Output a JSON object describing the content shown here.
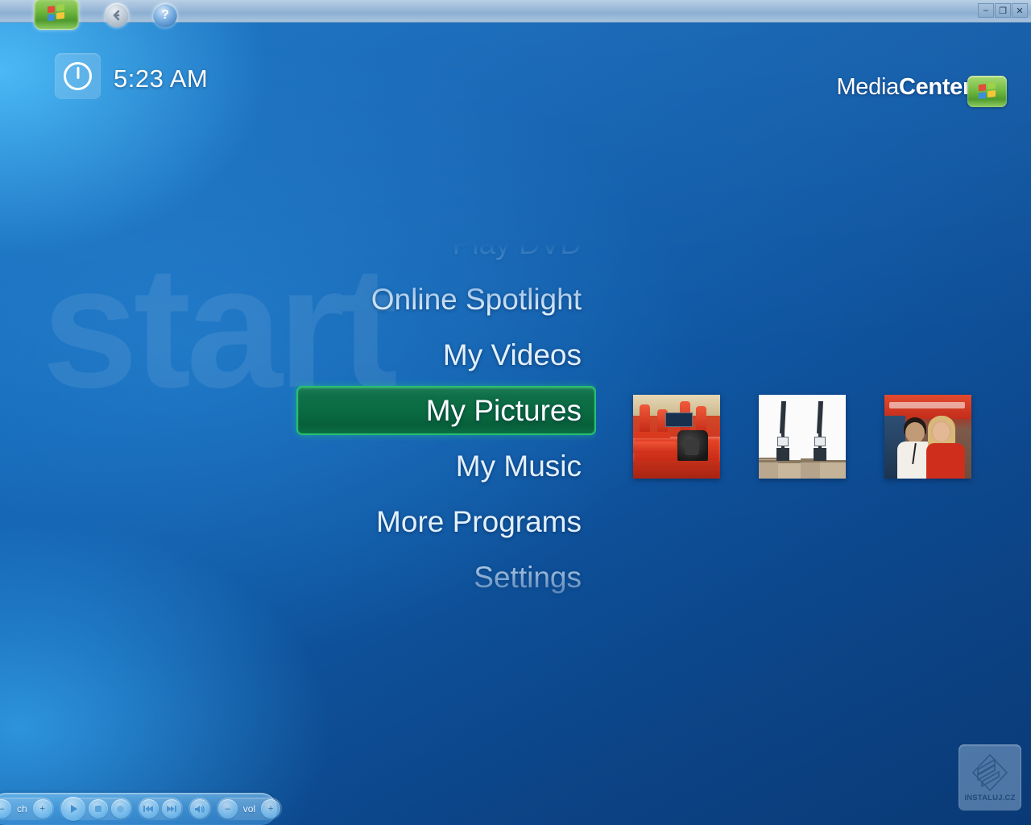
{
  "window": {
    "titlebar": {
      "start_orb": "mce-start-orb-icon",
      "back_button_label": "←",
      "help_button_label": "?",
      "controls": [
        {
          "name": "minimize",
          "glyph": "–"
        },
        {
          "name": "restore",
          "glyph": "❐"
        },
        {
          "name": "close",
          "glyph": "✕"
        }
      ]
    }
  },
  "header": {
    "power_button_name": "power-icon",
    "clock": "5:23 AM",
    "brand_light": "Media",
    "brand_bold": "Center",
    "brand_logo_name": "windows-flag-icon"
  },
  "background": {
    "watermark_text": "start",
    "accent_blue": "#1372c4",
    "deep_blue": "#0b3f7e",
    "glow_cyan": "#48bffa"
  },
  "menu": {
    "items": [
      {
        "label": "Play DVD",
        "selected": false,
        "faded": true
      },
      {
        "label": "Online Spotlight",
        "selected": false,
        "faded": false
      },
      {
        "label": "My Videos",
        "selected": false,
        "faded": false
      },
      {
        "label": "My Pictures",
        "selected": true,
        "faded": false
      },
      {
        "label": "My Music",
        "selected": false,
        "faded": false
      },
      {
        "label": "More Programs",
        "selected": false,
        "faded": false
      },
      {
        "label": "Settings",
        "selected": false,
        "faded": true
      }
    ],
    "selected_color": "#0a6b42",
    "selected_border": "#27c06e"
  },
  "thumbnails": [
    {
      "name": "thumbnail-f1-car",
      "alt": "Red Formula 1 race car in pit garage"
    },
    {
      "name": "thumbnail-cranes",
      "alt": "Two dockside cranes against white sky"
    },
    {
      "name": "thumbnail-people",
      "alt": "Two people posing at an exhibition stand"
    }
  ],
  "transport": {
    "channel_label": "ch",
    "volume_label": "vol",
    "buttons": [
      {
        "name": "channel-down-button",
        "glyph": "–"
      },
      {
        "name": "channel-up-button",
        "glyph": "+"
      },
      {
        "name": "play-button",
        "glyph": "▶"
      },
      {
        "name": "stop-button",
        "glyph": "■"
      },
      {
        "name": "record-button",
        "glyph": "●"
      },
      {
        "name": "skip-back-button",
        "glyph": "⏮"
      },
      {
        "name": "skip-forward-button",
        "glyph": "⏭"
      },
      {
        "name": "mute-button",
        "glyph": "🔈"
      },
      {
        "name": "volume-down-button",
        "glyph": "–"
      },
      {
        "name": "volume-up-button",
        "glyph": "+"
      }
    ]
  },
  "watermark": {
    "text": "INSTALUJ.CZ"
  }
}
